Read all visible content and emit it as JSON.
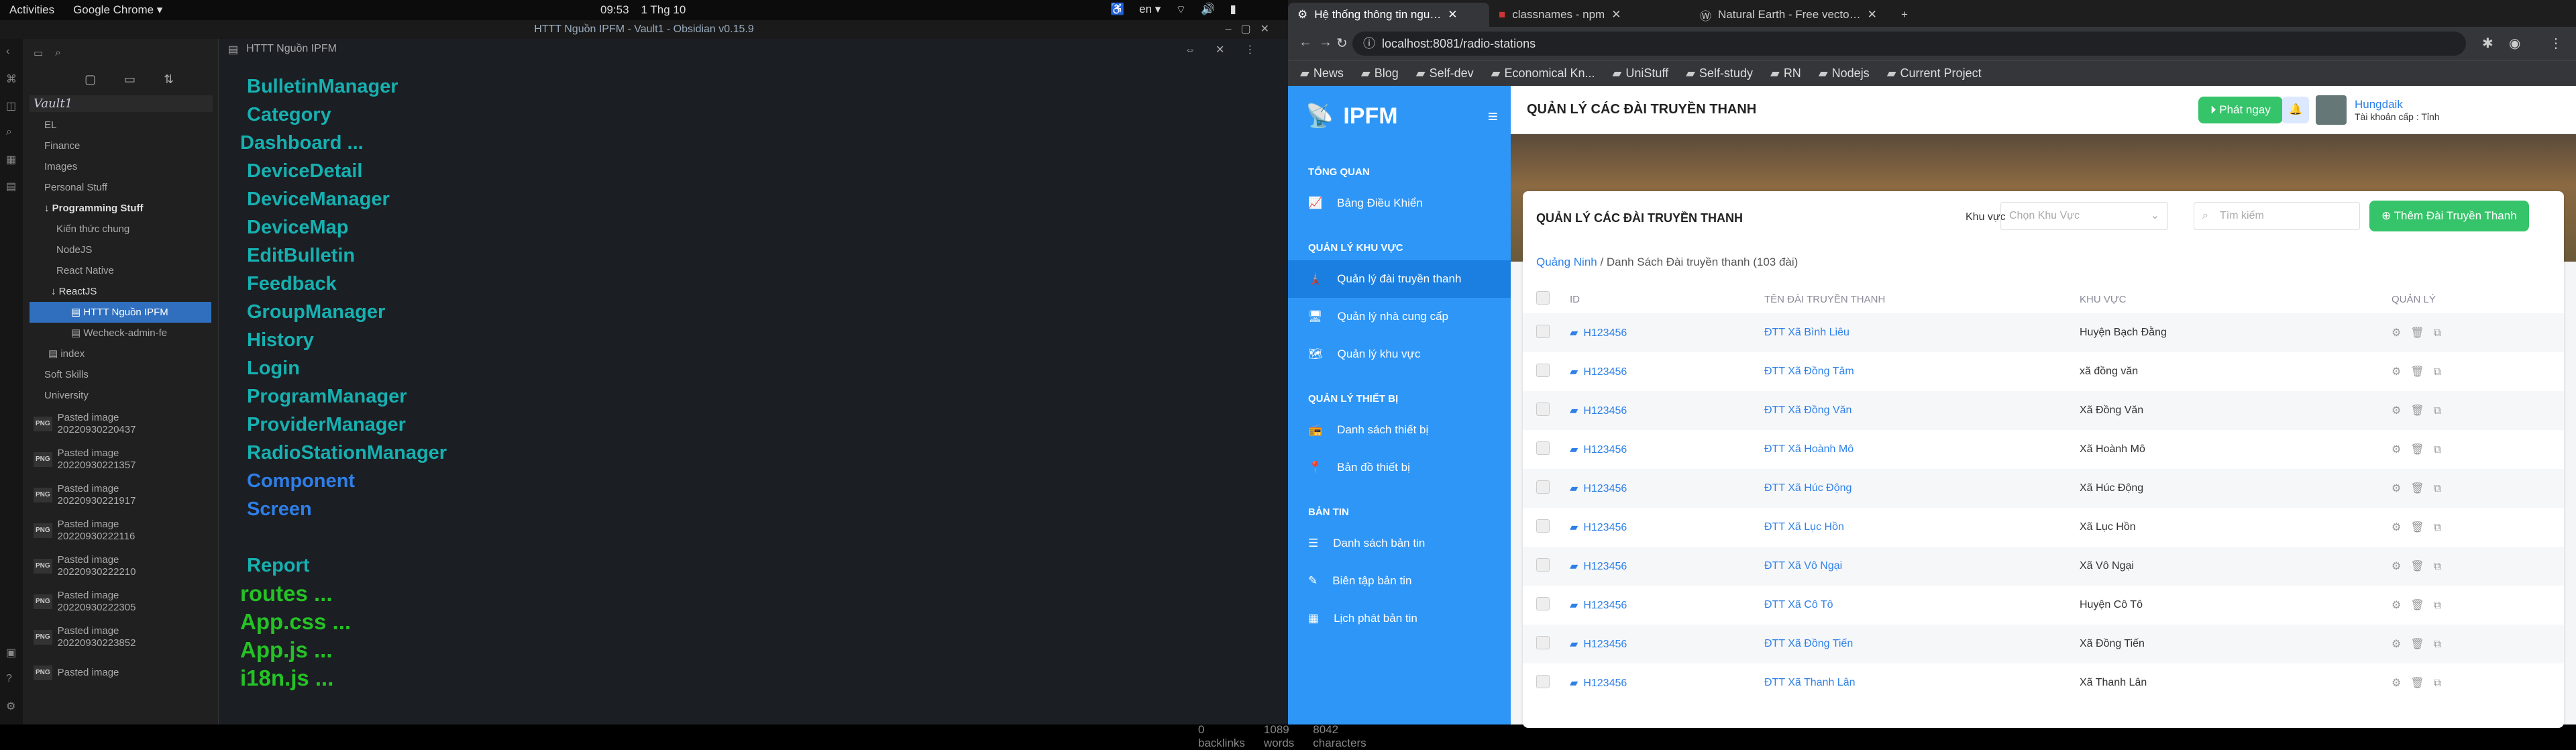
{
  "sys": {
    "activities": "Activities",
    "app": "Google Chrome ▾",
    "time": "09:53",
    "date": "1 Thg 10",
    "lang": "en ▾"
  },
  "obsidian": {
    "title": "HTTT Nguồn IPFM - Vault1 - Obsidian v0.15.9",
    "vault": "Vault1",
    "tree": [
      "EL",
      "Finance",
      "Images",
      "Personal Stuff",
      "Programming Stuff",
      "Kiến thức chung",
      "NodeJS",
      "React Native",
      "ReactJS",
      "HTTT Nguồn IPFM",
      "Wecheck-admin-fe",
      "index",
      "Soft Skills",
      "University"
    ],
    "images": [
      {
        "name": "Pasted image",
        "date": "20220930220437"
      },
      {
        "name": "Pasted image",
        "date": "20220930221357"
      },
      {
        "name": "Pasted image",
        "date": "20220930221917"
      },
      {
        "name": "Pasted image",
        "date": "20220930222116"
      },
      {
        "name": "Pasted image",
        "date": "20220930222210"
      },
      {
        "name": "Pasted image",
        "date": "20220930222305"
      },
      {
        "name": "Pasted image",
        "date": "20220930223852"
      },
      {
        "name": "Pasted image",
        "date": ""
      }
    ],
    "file_title": "HTTT Nguồn IPFM",
    "lines": [
      "BulletinManager",
      "Category",
      "Dashboard ...",
      "DeviceDetail",
      "DeviceManager",
      "DeviceMap",
      "EditBulletin",
      "Feedback",
      "GroupManager",
      "History",
      "Login",
      "ProgramManager",
      "ProviderManager",
      "RadioStationManager",
      "Component",
      "Screen",
      "",
      "Report",
      "routes ...",
      "App.css ...",
      "App.js ...",
      "i18n.js ..."
    ],
    "status": {
      "backlinks": "0 backlinks",
      "words": "1089 words",
      "chars": "8042 characters"
    }
  },
  "chrome": {
    "tabs": [
      "Hệ thống thông tin ngu…",
      "classnames - npm",
      "Natural Earth - Free vecto…"
    ],
    "url": "localhost:8081/radio-stations",
    "bookmarks": [
      "News",
      "Blog",
      "Self-dev",
      "Economical Kn...",
      "UniStuff",
      "Self-study",
      "RN",
      "Nodejs",
      "Current Project"
    ]
  },
  "app": {
    "logo": "IPFM",
    "sections": [
      {
        "title": "TỔNG QUAN",
        "items": [
          "Bảng Điều Khiển"
        ]
      },
      {
        "title": "QUẢN LÝ KHU VỰC",
        "items": [
          "Quản lý đài truyền thanh",
          "Quản lý nhà cung cấp",
          "Quản lý khu vực"
        ]
      },
      {
        "title": "QUẢN LÝ THIẾT BỊ",
        "items": [
          "Danh sách thiết bị",
          "Bản đồ thiết bị"
        ]
      },
      {
        "title": "BẢN TIN",
        "items": [
          "Danh sách bản tin",
          "Biên tập bản tin",
          "Lịch phát bản tin"
        ]
      }
    ],
    "page_title": "QUẢN LÝ CÁC ĐÀI TRUYỀN THANH",
    "broadcast_btn": "Phát ngay",
    "user_name": "Hungdaik",
    "user_role": "Tài khoản cấp : Tỉnh",
    "card_title": "QUẢN LÝ CÁC ĐÀI TRUYỀN THANH",
    "region_label": "Khu vực",
    "region_placeholder": "Chọn Khu Vực",
    "search_placeholder": "Tìm kiếm",
    "add_btn": "Thêm Đài Truyền Thanh",
    "crumb_root": "Quảng Ninh",
    "crumb_rest": "Danh Sách Đài truyền thanh (103 đài)",
    "columns": [
      "ID",
      "TÊN ĐÀI TRUYỀN THANH",
      "KHU VỰC",
      "QUẢN LÝ"
    ],
    "rows": [
      {
        "id": "H123456",
        "name": "ĐTT Xã Bình Liêu",
        "region": "Huyện Bạch Đằng"
      },
      {
        "id": "H123456",
        "name": "ĐTT Xã Đồng Tâm",
        "region": "xã đồng văn"
      },
      {
        "id": "H123456",
        "name": "ĐTT Xã Đồng Văn",
        "region": "Xã Đồng Văn"
      },
      {
        "id": "H123456",
        "name": "ĐTT Xã Hoành Mô",
        "region": "Xã Hoành Mô"
      },
      {
        "id": "H123456",
        "name": "ĐTT Xã Húc Động",
        "region": "Xã Húc Động"
      },
      {
        "id": "H123456",
        "name": "ĐTT Xã Lục Hồn",
        "region": "Xã Lục Hồn"
      },
      {
        "id": "H123456",
        "name": "ĐTT Xã Vô Ngại",
        "region": "Xã Vô Ngại"
      },
      {
        "id": "H123456",
        "name": "ĐTT Xã Cô Tô",
        "region": "Huyện Cô Tô"
      },
      {
        "id": "H123456",
        "name": "ĐTT Xã Đồng Tiến",
        "region": "Xã Đồng Tiến"
      },
      {
        "id": "H123456",
        "name": "ĐTT Xã Thanh Lân",
        "region": "Xã Thanh Lân"
      }
    ]
  }
}
